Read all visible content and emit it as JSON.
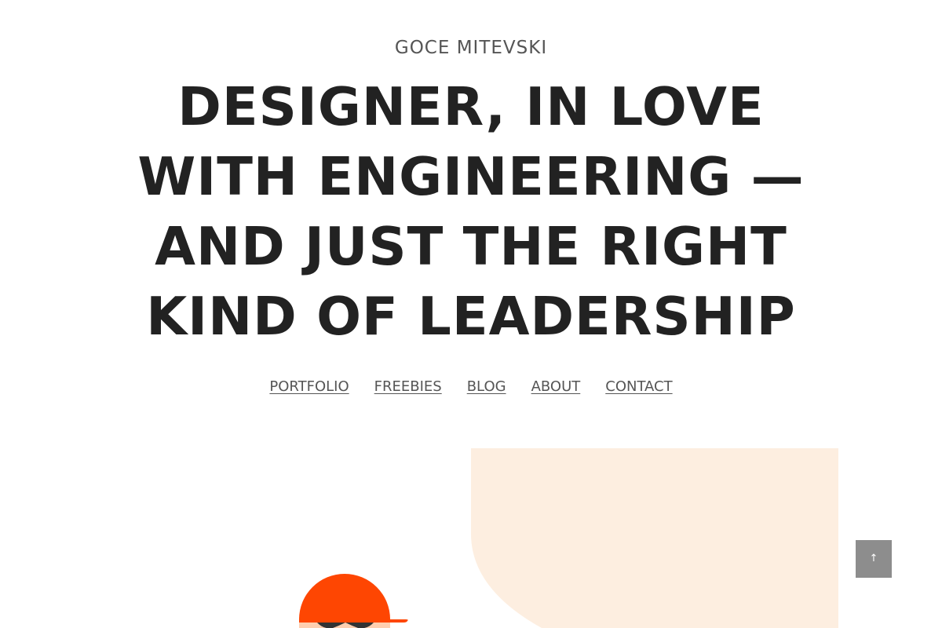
{
  "header": {
    "site_name": "GOCE MITEVSKI",
    "headline_lines": [
      "DESIGNER, IN LOVE",
      "WITH ENGINEERING —",
      "AND JUST THE RIGHT",
      "KIND OF LEADERSHIP"
    ]
  },
  "nav": {
    "items": [
      {
        "label": "PORTFOLIO"
      },
      {
        "label": "FREEBIES"
      },
      {
        "label": "BLOG"
      },
      {
        "label": "ABOUT"
      },
      {
        "label": "CONTACT"
      }
    ]
  },
  "hero": {
    "panel_color": "#fdeee0",
    "cap_color": "#fe4602",
    "face_color": "#ffcfb0",
    "glasses_color": "#333333"
  },
  "scroll_top": {
    "label": "↑",
    "icon": "arrow-up-icon",
    "color": "#8d8d8d"
  }
}
